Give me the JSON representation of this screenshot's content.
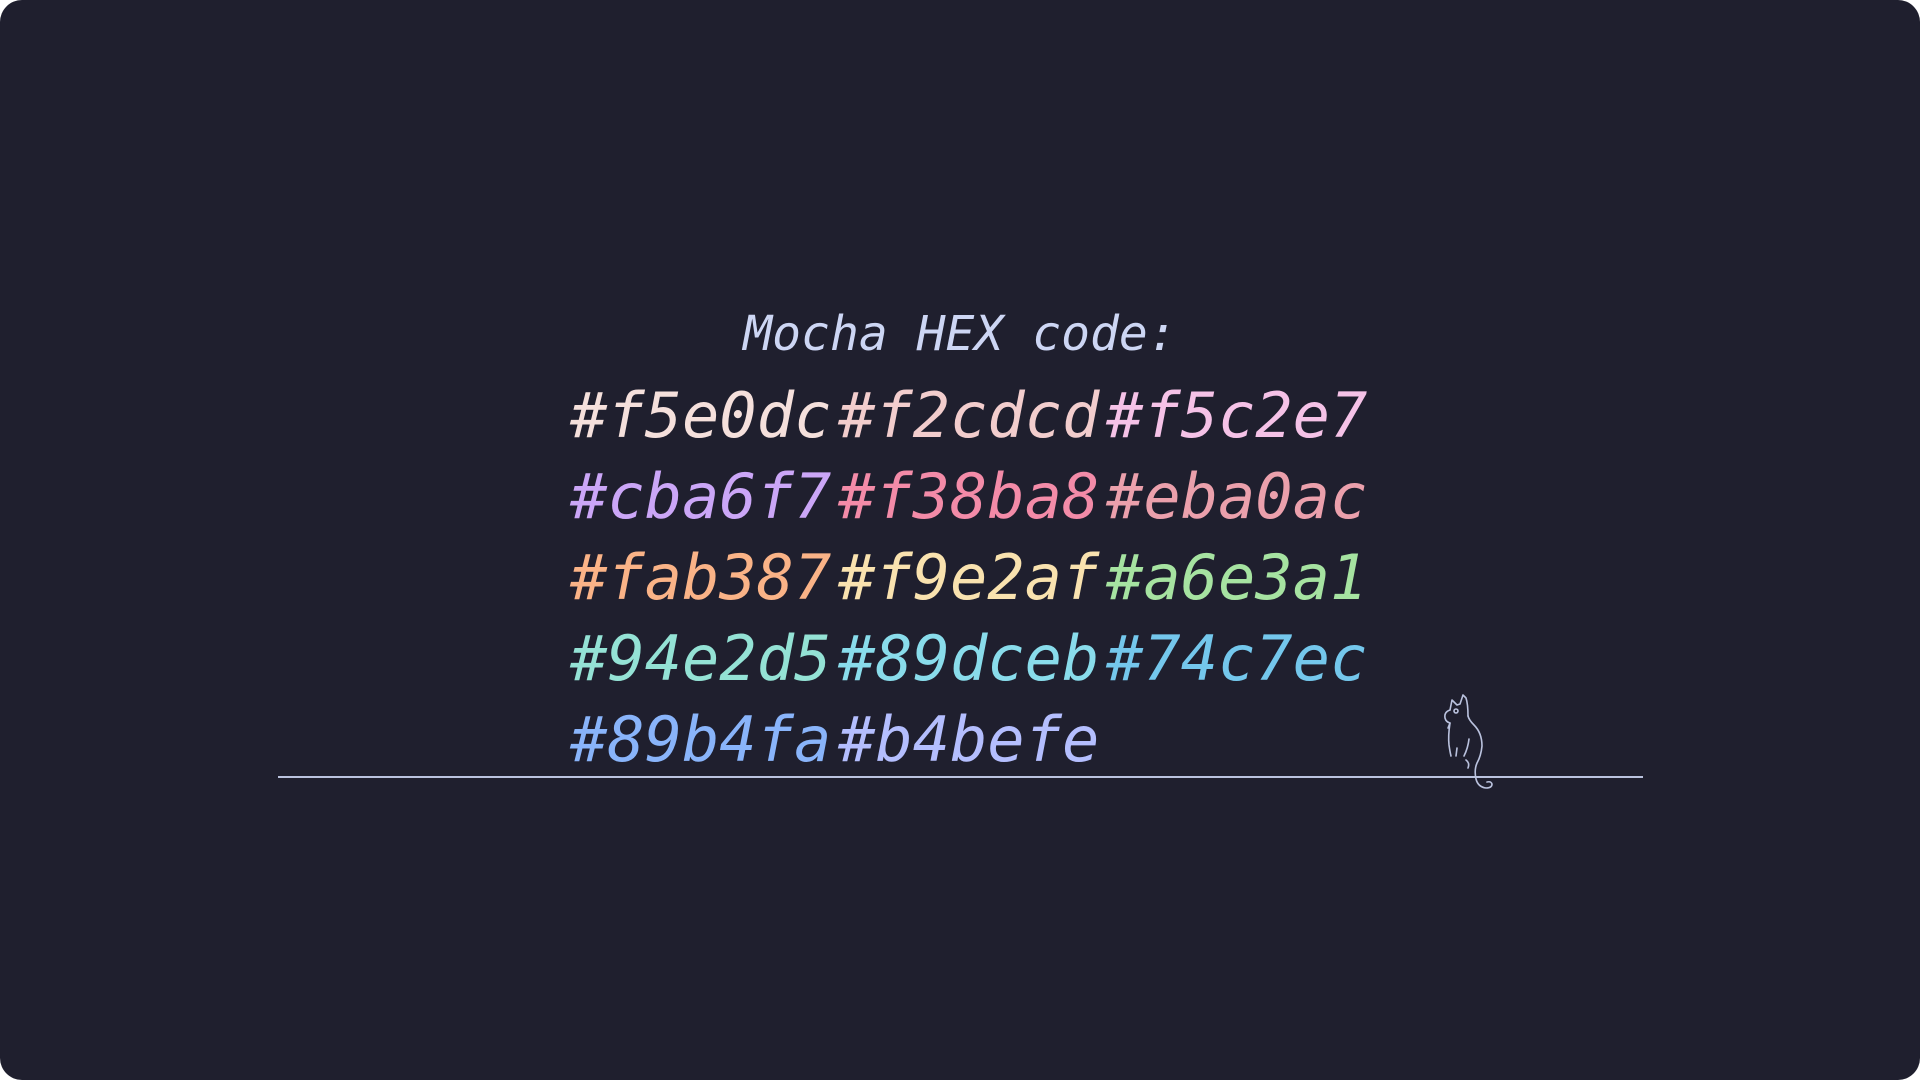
{
  "heading": {
    "text": "Mocha HEX code:",
    "color": "#cdd6f4"
  },
  "swatches": [
    {
      "code": "#f5e0dc",
      "color": "#f5e0dc"
    },
    {
      "code": "#f2cdcd",
      "color": "#f2cdcd"
    },
    {
      "code": "#f5c2e7",
      "color": "#f5c2e7"
    },
    {
      "code": "#cba6f7",
      "color": "#cba6f7"
    },
    {
      "code": "#f38ba8",
      "color": "#f38ba8"
    },
    {
      "code": "#eba0ac",
      "color": "#eba0ac"
    },
    {
      "code": "#fab387",
      "color": "#fab387"
    },
    {
      "code": "#f9e2af",
      "color": "#f9e2af"
    },
    {
      "code": "#a6e3a1",
      "color": "#a6e3a1"
    },
    {
      "code": "#94e2d5",
      "color": "#94e2d5"
    },
    {
      "code": "#89dceb",
      "color": "#89dceb"
    },
    {
      "code": "#74c7ec",
      "color": "#74c7ec"
    },
    {
      "code": "#89b4fa",
      "color": "#89b4fa"
    },
    {
      "code": "#b4befe",
      "color": "#b4befe"
    }
  ],
  "colors": {
    "background": "#1f1f2e",
    "line": "#bac2de"
  },
  "icons": {
    "cat": "sitting-cat-line-icon"
  }
}
